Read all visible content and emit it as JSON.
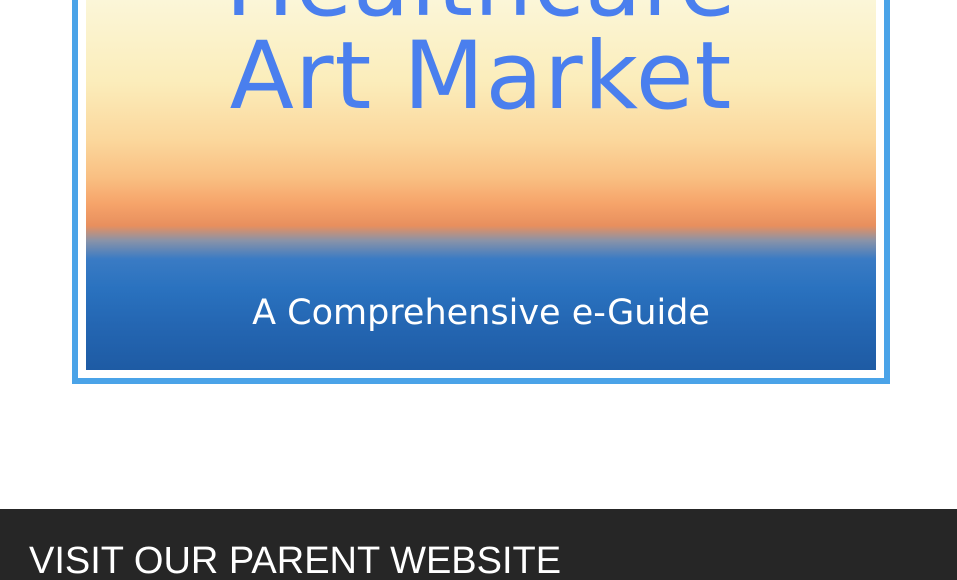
{
  "book": {
    "title_line_1": "Healthcare",
    "title_line_2": "Art Market",
    "subtitle": "A Comprehensive e-Guide"
  },
  "footer": {
    "heading": "VISIT OUR PARENT WEBSITE"
  },
  "colors": {
    "title_blue": "#4a7fee",
    "frame_blue": "#4aa3e8",
    "footer_background": "#262626"
  }
}
